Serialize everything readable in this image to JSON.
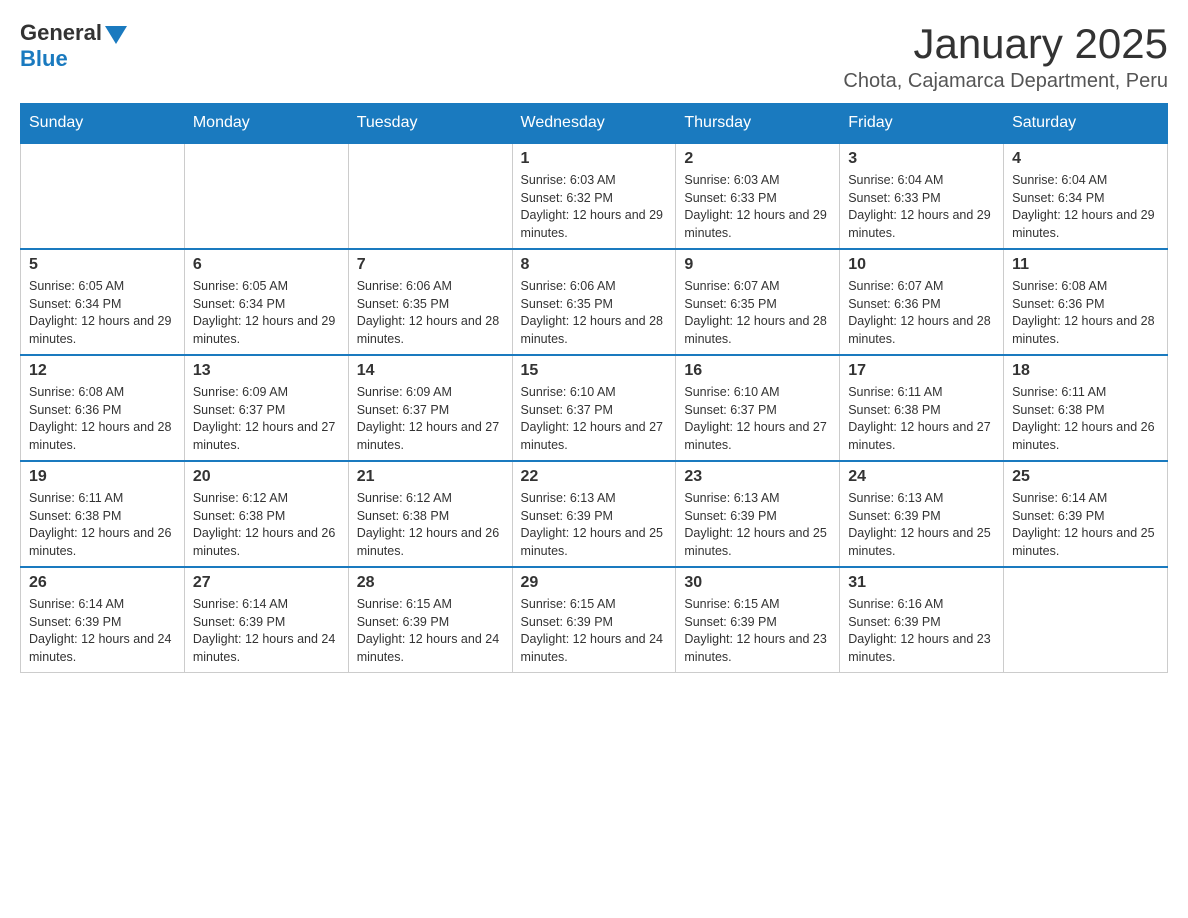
{
  "header": {
    "logo": {
      "general": "General",
      "blue": "Blue"
    },
    "title": "January 2025",
    "subtitle": "Chota, Cajamarca Department, Peru"
  },
  "calendar": {
    "days_of_week": [
      "Sunday",
      "Monday",
      "Tuesday",
      "Wednesday",
      "Thursday",
      "Friday",
      "Saturday"
    ],
    "weeks": [
      [
        {
          "date": "",
          "info": ""
        },
        {
          "date": "",
          "info": ""
        },
        {
          "date": "",
          "info": ""
        },
        {
          "date": "1",
          "info": "Sunrise: 6:03 AM\nSunset: 6:32 PM\nDaylight: 12 hours and 29 minutes."
        },
        {
          "date": "2",
          "info": "Sunrise: 6:03 AM\nSunset: 6:33 PM\nDaylight: 12 hours and 29 minutes."
        },
        {
          "date": "3",
          "info": "Sunrise: 6:04 AM\nSunset: 6:33 PM\nDaylight: 12 hours and 29 minutes."
        },
        {
          "date": "4",
          "info": "Sunrise: 6:04 AM\nSunset: 6:34 PM\nDaylight: 12 hours and 29 minutes."
        }
      ],
      [
        {
          "date": "5",
          "info": "Sunrise: 6:05 AM\nSunset: 6:34 PM\nDaylight: 12 hours and 29 minutes."
        },
        {
          "date": "6",
          "info": "Sunrise: 6:05 AM\nSunset: 6:34 PM\nDaylight: 12 hours and 29 minutes."
        },
        {
          "date": "7",
          "info": "Sunrise: 6:06 AM\nSunset: 6:35 PM\nDaylight: 12 hours and 28 minutes."
        },
        {
          "date": "8",
          "info": "Sunrise: 6:06 AM\nSunset: 6:35 PM\nDaylight: 12 hours and 28 minutes."
        },
        {
          "date": "9",
          "info": "Sunrise: 6:07 AM\nSunset: 6:35 PM\nDaylight: 12 hours and 28 minutes."
        },
        {
          "date": "10",
          "info": "Sunrise: 6:07 AM\nSunset: 6:36 PM\nDaylight: 12 hours and 28 minutes."
        },
        {
          "date": "11",
          "info": "Sunrise: 6:08 AM\nSunset: 6:36 PM\nDaylight: 12 hours and 28 minutes."
        }
      ],
      [
        {
          "date": "12",
          "info": "Sunrise: 6:08 AM\nSunset: 6:36 PM\nDaylight: 12 hours and 28 minutes."
        },
        {
          "date": "13",
          "info": "Sunrise: 6:09 AM\nSunset: 6:37 PM\nDaylight: 12 hours and 27 minutes."
        },
        {
          "date": "14",
          "info": "Sunrise: 6:09 AM\nSunset: 6:37 PM\nDaylight: 12 hours and 27 minutes."
        },
        {
          "date": "15",
          "info": "Sunrise: 6:10 AM\nSunset: 6:37 PM\nDaylight: 12 hours and 27 minutes."
        },
        {
          "date": "16",
          "info": "Sunrise: 6:10 AM\nSunset: 6:37 PM\nDaylight: 12 hours and 27 minutes."
        },
        {
          "date": "17",
          "info": "Sunrise: 6:11 AM\nSunset: 6:38 PM\nDaylight: 12 hours and 27 minutes."
        },
        {
          "date": "18",
          "info": "Sunrise: 6:11 AM\nSunset: 6:38 PM\nDaylight: 12 hours and 26 minutes."
        }
      ],
      [
        {
          "date": "19",
          "info": "Sunrise: 6:11 AM\nSunset: 6:38 PM\nDaylight: 12 hours and 26 minutes."
        },
        {
          "date": "20",
          "info": "Sunrise: 6:12 AM\nSunset: 6:38 PM\nDaylight: 12 hours and 26 minutes."
        },
        {
          "date": "21",
          "info": "Sunrise: 6:12 AM\nSunset: 6:38 PM\nDaylight: 12 hours and 26 minutes."
        },
        {
          "date": "22",
          "info": "Sunrise: 6:13 AM\nSunset: 6:39 PM\nDaylight: 12 hours and 25 minutes."
        },
        {
          "date": "23",
          "info": "Sunrise: 6:13 AM\nSunset: 6:39 PM\nDaylight: 12 hours and 25 minutes."
        },
        {
          "date": "24",
          "info": "Sunrise: 6:13 AM\nSunset: 6:39 PM\nDaylight: 12 hours and 25 minutes."
        },
        {
          "date": "25",
          "info": "Sunrise: 6:14 AM\nSunset: 6:39 PM\nDaylight: 12 hours and 25 minutes."
        }
      ],
      [
        {
          "date": "26",
          "info": "Sunrise: 6:14 AM\nSunset: 6:39 PM\nDaylight: 12 hours and 24 minutes."
        },
        {
          "date": "27",
          "info": "Sunrise: 6:14 AM\nSunset: 6:39 PM\nDaylight: 12 hours and 24 minutes."
        },
        {
          "date": "28",
          "info": "Sunrise: 6:15 AM\nSunset: 6:39 PM\nDaylight: 12 hours and 24 minutes."
        },
        {
          "date": "29",
          "info": "Sunrise: 6:15 AM\nSunset: 6:39 PM\nDaylight: 12 hours and 24 minutes."
        },
        {
          "date": "30",
          "info": "Sunrise: 6:15 AM\nSunset: 6:39 PM\nDaylight: 12 hours and 23 minutes."
        },
        {
          "date": "31",
          "info": "Sunrise: 6:16 AM\nSunset: 6:39 PM\nDaylight: 12 hours and 23 minutes."
        },
        {
          "date": "",
          "info": ""
        }
      ]
    ]
  }
}
